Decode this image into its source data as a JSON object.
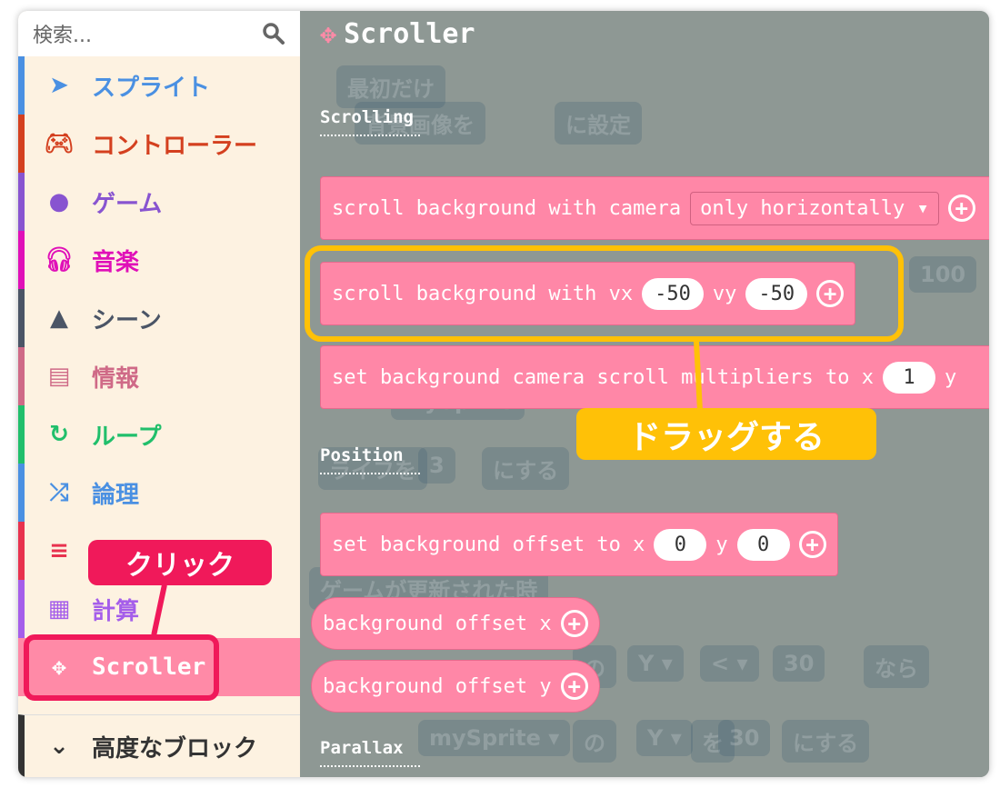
{
  "search": {
    "placeholder": "検索...",
    "icon": "search-icon"
  },
  "categories": [
    {
      "label": "スプライト",
      "icon": "paper-plane-icon",
      "color": "#4a90e2"
    },
    {
      "label": "コントローラー",
      "icon": "gamepad-icon",
      "color": "#d4401f"
    },
    {
      "label": "ゲーム",
      "icon": "circle-icon",
      "color": "#8854d0"
    },
    {
      "label": "音楽",
      "icon": "headphones-icon",
      "color": "#e010b8"
    },
    {
      "label": "シーン",
      "icon": "tree-icon",
      "color": "#4b5566"
    },
    {
      "label": "情報",
      "icon": "id-card-icon",
      "color": "#cf6a87"
    },
    {
      "label": "ループ",
      "icon": "refresh-icon",
      "color": "#20bf6b"
    },
    {
      "label": "論理",
      "icon": "shuffle-icon",
      "color": "#4a90e2"
    },
    {
      "label": "",
      "icon": "list-icon",
      "color": "#e8324e"
    },
    {
      "label": "計算",
      "icon": "calculator-icon",
      "color": "#a55eea"
    },
    {
      "label": "Scroller",
      "icon": "move-arrows-icon",
      "color": "#ff8aa7",
      "selected": true
    }
  ],
  "advanced": {
    "label": "高度なブロック",
    "icon": "chevron-down-icon"
  },
  "flyout": {
    "title": "Scroller",
    "sections": {
      "scrolling": "Scrolling",
      "position": "Position",
      "parallax": "Parallax"
    },
    "blocks": {
      "b1": {
        "text": "scroll background with camera",
        "dropdown": "only horizontally ▾"
      },
      "b2": {
        "text": "scroll background with vx",
        "vx": "-50",
        "vy_label": "vy",
        "vy": "-50"
      },
      "b3": {
        "text": "set background camera scroll multipliers to x",
        "x": "1",
        "y_label": "y"
      },
      "b4": {
        "text": "set background offset to x",
        "x": "0",
        "y_label": "y",
        "y": "0"
      },
      "b5": {
        "text": "background offset x"
      },
      "b6": {
        "text": "background offset y"
      }
    }
  },
  "workspace_ghost": [
    "最初だけ",
    "背景画像を",
    "に設定",
    "100",
    "mySprite",
    "ライフを",
    "3",
    "にする",
    "ゲームが更新された時",
    "の",
    "Y ▾",
    "< ▾",
    "30",
    "なら",
    "mySprite ▾",
    "の",
    "Y ▾",
    "を",
    "30",
    "にする"
  ],
  "annotations": {
    "drag": "ドラッグする",
    "click": "クリック",
    "drag_color": "#ffc107",
    "click_color": "#f0195a"
  },
  "colors": {
    "block": "#ff87a7",
    "flyout_bg": "#8e9894"
  }
}
